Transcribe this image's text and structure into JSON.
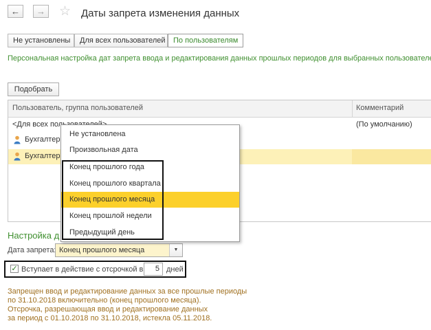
{
  "header": {
    "back_icon": "←",
    "forward_icon": "→",
    "star_icon": "☆",
    "title": "Даты запрета изменения данных"
  },
  "tabs": [
    {
      "label": "Не установлены",
      "active": false
    },
    {
      "label": "Для всех пользователей",
      "active": false
    },
    {
      "label": "По пользователям",
      "active": true
    }
  ],
  "info_text": "Персональная настройка дат запрета ввода и редактирования данных прошлых периодов для выбранных пользователей.",
  "pick_button": "Подобрать",
  "table": {
    "columns": [
      "Пользователь, группа пользователей",
      "Комментарий"
    ],
    "rows": [
      {
        "user": "<Для всех пользователей>",
        "comment": "(По умолчанию)",
        "icon": null,
        "selected": false
      },
      {
        "user": "Бухгалтер",
        "comment": "",
        "icon": "person-icon",
        "selected": false
      },
      {
        "user": "Бухгалтер",
        "comment": "",
        "icon": "person-icon",
        "selected": true
      }
    ]
  },
  "dropdown": {
    "items": [
      "Не установлена",
      "Произвольная дата",
      "Конец прошлого года",
      "Конец прошлого квартала",
      "Конец прошлого месяца",
      "Конец прошлой недели",
      "Предыдущий день"
    ],
    "selected_index": 4
  },
  "settings": {
    "heading": "Настройка д",
    "date_label": "Дата запрета:",
    "date_value": "Конец прошлого месяца",
    "delay_label": "Вступает в действие с отсрочкой в",
    "delay_checked": true,
    "delay_value": "5",
    "delay_unit": "дней"
  },
  "notes": [
    "Запрещен ввод и редактирование данных за все прошлые периоды",
    "по 31.10.2018 включительно (конец прошлого месяца).",
    "Отсрочка, разрешающая ввод и редактирование данных",
    "за период с 01.10.2018 по 31.10.2018, истекла 05.11.2018."
  ],
  "colors": {
    "accent_green": "#3f8f2f",
    "selection_yellow": "#fcd02b",
    "row_highlight": "#fdf1b8",
    "note_brown": "#a07020"
  }
}
